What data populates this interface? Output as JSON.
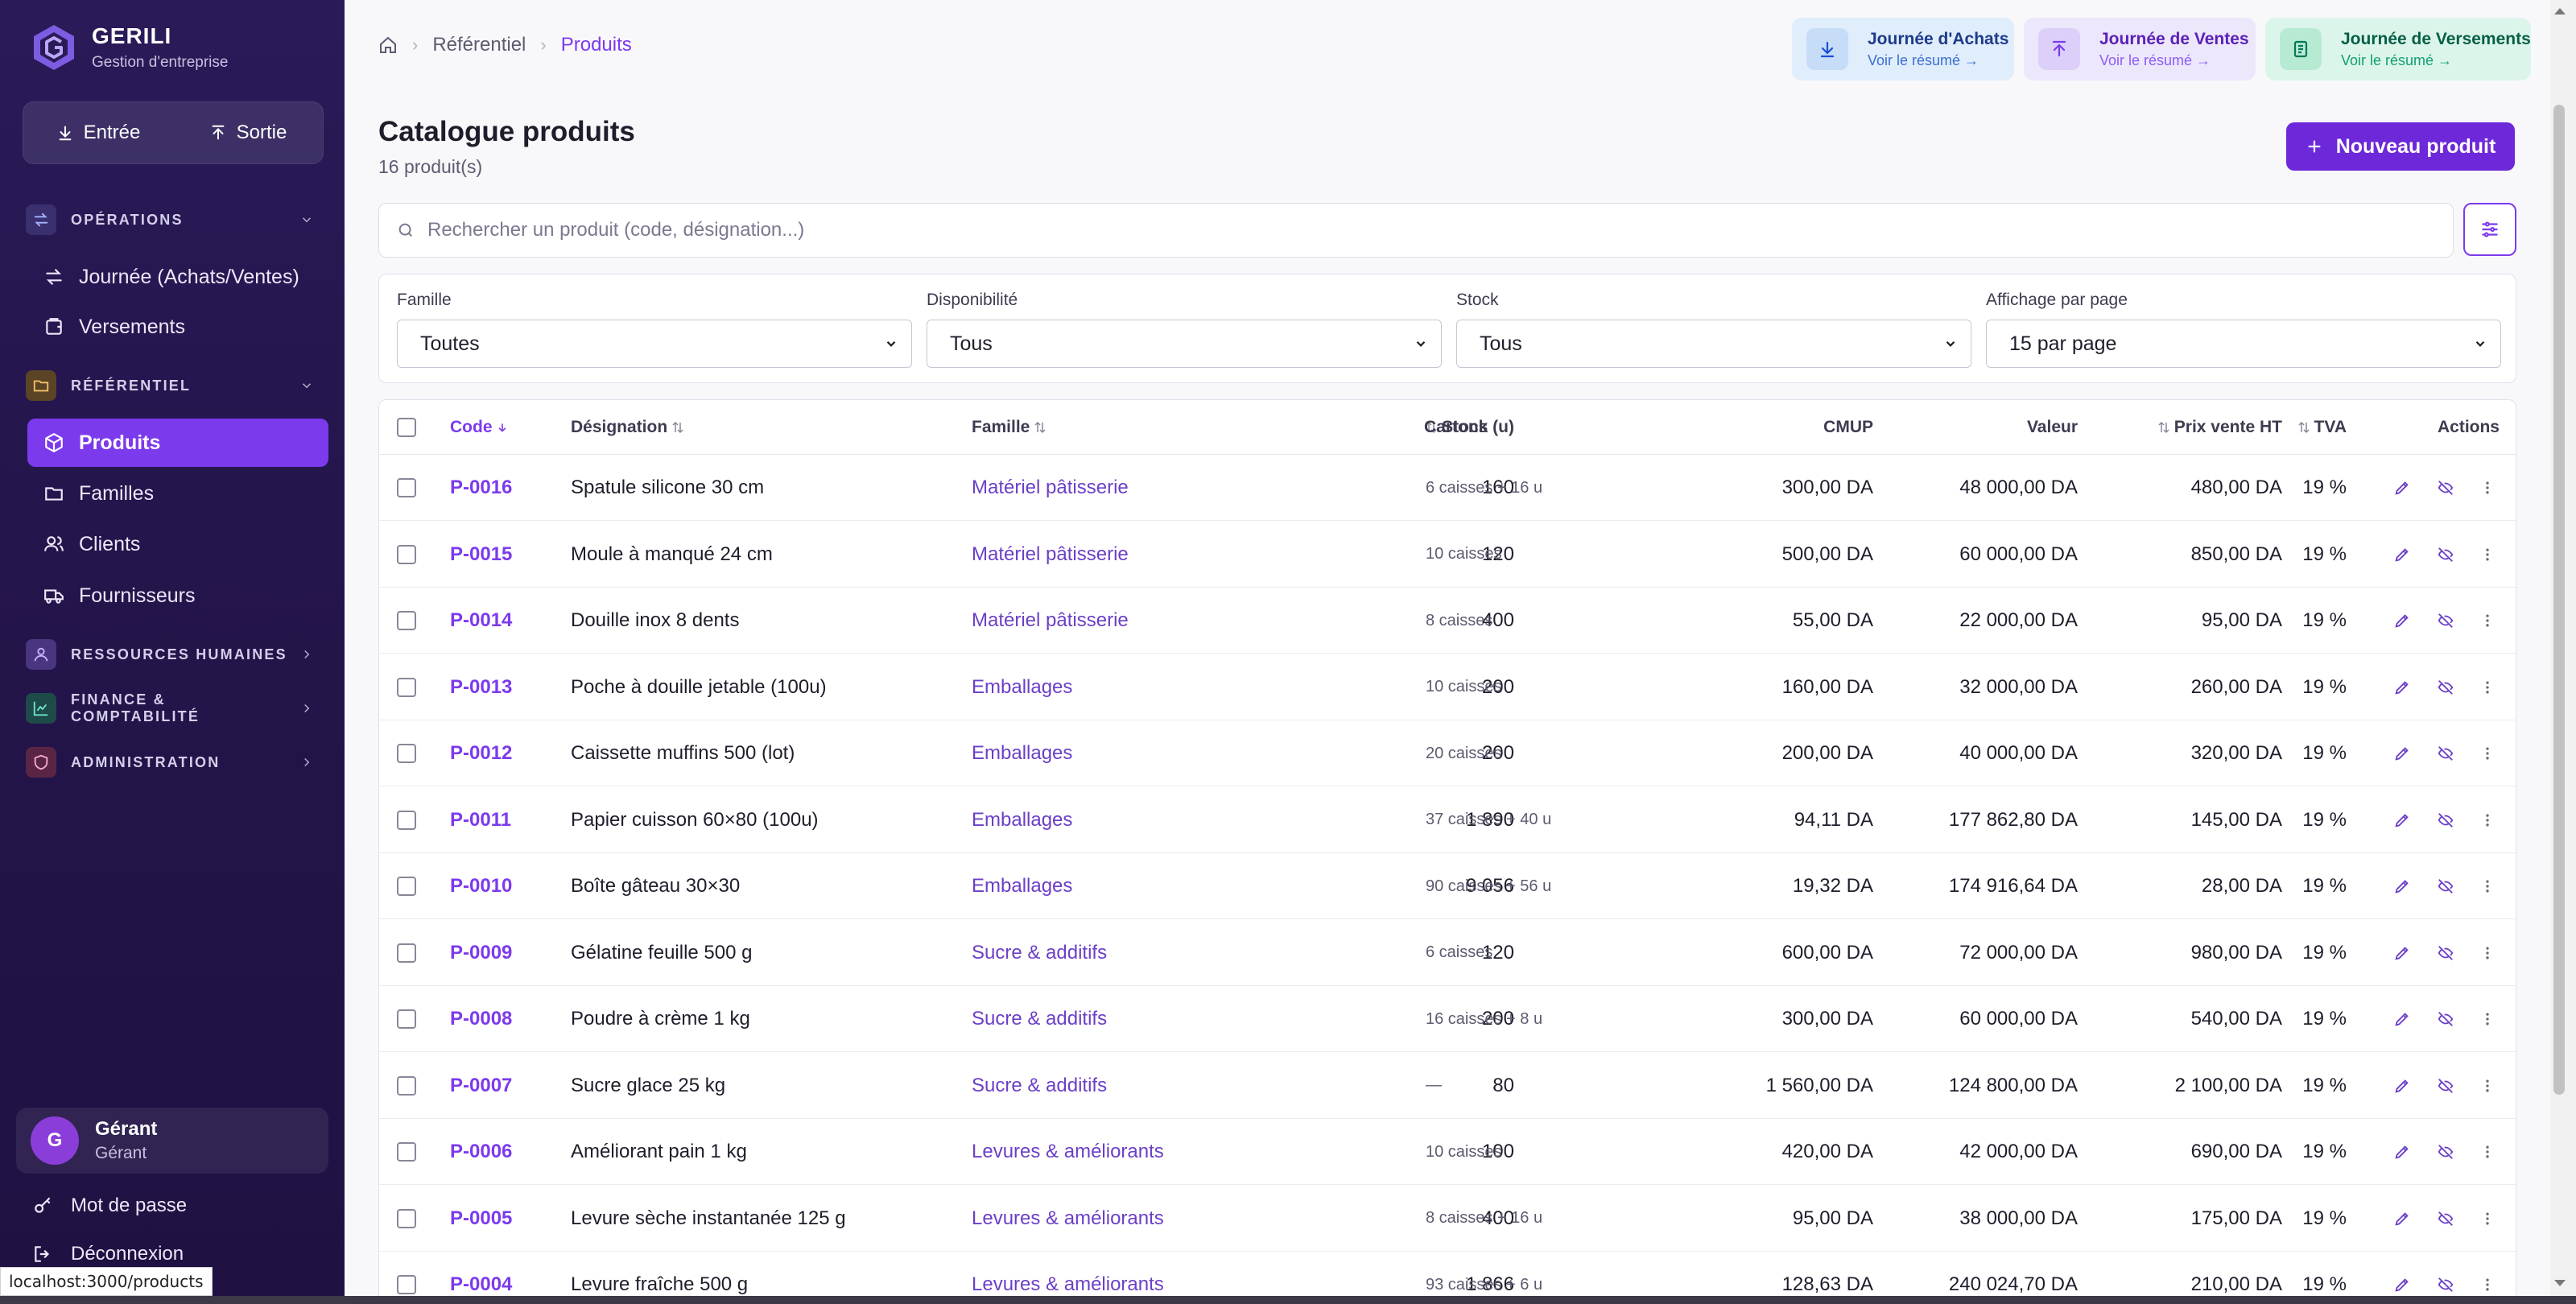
{
  "app": {
    "name": "GERILI",
    "subtitle": "Gestion d'entreprise"
  },
  "quick_actions": {
    "entree": "Entrée",
    "sortie": "Sortie"
  },
  "sidebar": {
    "sections": [
      {
        "label": "OPÉRATIONS",
        "icon": "arrows-exchange-icon",
        "expanded": true
      },
      {
        "label": "RÉFÉRENTIEL",
        "icon": "folder-icon",
        "expanded": true
      },
      {
        "label": "RESSOURCES HUMAINES",
        "icon": "user-icon",
        "expanded": false
      },
      {
        "label": "FINANCE & COMPTABILITÉ",
        "icon": "chart-line-icon",
        "expanded": false
      },
      {
        "label": "ADMINISTRATION",
        "icon": "shield-icon",
        "expanded": false
      }
    ],
    "operations_items": [
      {
        "label": "Journée (Achats/Ventes)",
        "icon": "arrows-exchange-icon"
      },
      {
        "label": "Versements",
        "icon": "wallet-icon"
      }
    ],
    "referentiel_items": [
      {
        "label": "Produits",
        "icon": "box-icon",
        "active": true
      },
      {
        "label": "Familles",
        "icon": "folder-icon"
      },
      {
        "label": "Clients",
        "icon": "users-icon"
      },
      {
        "label": "Fournisseurs",
        "icon": "truck-icon"
      }
    ]
  },
  "user": {
    "initial": "G",
    "name": "Gérant",
    "role": "Gérant"
  },
  "bottom_links": {
    "password": "Mot de passe",
    "logout": "Déconnexion"
  },
  "status_bar": {
    "url": "localhost:3000/products"
  },
  "breadcrumb": {
    "home_icon": "home-icon",
    "items": [
      "Référentiel",
      "Produits"
    ]
  },
  "journals": [
    {
      "title": "Journée d'Achats",
      "subtitle": "Voir le résumé →",
      "icon": "download-icon",
      "color": "#1d4ed8",
      "bg": "#e0edfb"
    },
    {
      "title": "Journée de Ventes",
      "subtitle": "Voir le résumé →",
      "icon": "upload-icon",
      "color": "#7c3aed",
      "bg": "#ede7fb"
    },
    {
      "title": "Journée de Versements",
      "subtitle": "Voir le résumé →",
      "icon": "receipt-icon",
      "color": "#047857",
      "bg": "#dcf5ea"
    }
  ],
  "page": {
    "title": "Catalogue produits",
    "count": "16 produit(s)",
    "new_button": "Nouveau produit"
  },
  "search": {
    "placeholder": "Rechercher un produit (code, désignation...)",
    "value": ""
  },
  "filters": [
    {
      "label": "Famille",
      "value": "Toutes"
    },
    {
      "label": "Disponibilité",
      "value": "Tous"
    },
    {
      "label": "Stock",
      "value": "Tous"
    },
    {
      "label": "Affichage par page",
      "value": "15 par page"
    }
  ],
  "table": {
    "headers": {
      "code": "Code",
      "designation": "Désignation",
      "famille": "Famille",
      "stock": "Stock (u)",
      "cartons": "Cartons",
      "cmup": "CMUP",
      "valeur": "Valeur",
      "prix": "Prix vente HT",
      "tva": "TVA",
      "actions": "Actions"
    },
    "rows": [
      {
        "code": "P-0016",
        "designation": "Spatule silicone 30 cm",
        "famille": "Matériel pâtisserie",
        "stock": "160",
        "cartons": "6 caisses + 16 u",
        "cmup": "300,00 DA",
        "valeur": "48 000,00 DA",
        "prix": "480,00 DA",
        "tva": "19 %"
      },
      {
        "code": "P-0015",
        "designation": "Moule à manqué 24 cm",
        "famille": "Matériel pâtisserie",
        "stock": "120",
        "cartons": "10 caisses",
        "cmup": "500,00 DA",
        "valeur": "60 000,00 DA",
        "prix": "850,00 DA",
        "tva": "19 %"
      },
      {
        "code": "P-0014",
        "designation": "Douille inox 8 dents",
        "famille": "Matériel pâtisserie",
        "stock": "400",
        "cartons": "8 caisses",
        "cmup": "55,00 DA",
        "valeur": "22 000,00 DA",
        "prix": "95,00 DA",
        "tva": "19 %"
      },
      {
        "code": "P-0013",
        "designation": "Poche à douille jetable (100u)",
        "famille": "Emballages",
        "stock": "200",
        "cartons": "10 caisses",
        "cmup": "160,00 DA",
        "valeur": "32 000,00 DA",
        "prix": "260,00 DA",
        "tva": "19 %"
      },
      {
        "code": "P-0012",
        "designation": "Caissette muffins 500 (lot)",
        "famille": "Emballages",
        "stock": "200",
        "cartons": "20 caisses",
        "cmup": "200,00 DA",
        "valeur": "40 000,00 DA",
        "prix": "320,00 DA",
        "tva": "19 %"
      },
      {
        "code": "P-0011",
        "designation": "Papier cuisson 60×80 (100u)",
        "famille": "Emballages",
        "stock": "1 890",
        "cartons": "37 caisses + 40 u",
        "cmup": "94,11 DA",
        "valeur": "177 862,80 DA",
        "prix": "145,00 DA",
        "tva": "19 %"
      },
      {
        "code": "P-0010",
        "designation": "Boîte gâteau 30×30",
        "famille": "Emballages",
        "stock": "9 056",
        "cartons": "90 caisses + 56 u",
        "cmup": "19,32 DA",
        "valeur": "174 916,64 DA",
        "prix": "28,00 DA",
        "tva": "19 %"
      },
      {
        "code": "P-0009",
        "designation": "Gélatine feuille 500 g",
        "famille": "Sucre & additifs",
        "stock": "120",
        "cartons": "6 caisses",
        "cmup": "600,00 DA",
        "valeur": "72 000,00 DA",
        "prix": "980,00 DA",
        "tva": "19 %"
      },
      {
        "code": "P-0008",
        "designation": "Poudre à crème 1 kg",
        "famille": "Sucre & additifs",
        "stock": "200",
        "cartons": "16 caisses + 8 u",
        "cmup": "300,00 DA",
        "valeur": "60 000,00 DA",
        "prix": "540,00 DA",
        "tva": "19 %"
      },
      {
        "code": "P-0007",
        "designation": "Sucre glace 25 kg",
        "famille": "Sucre & additifs",
        "stock": "80",
        "cartons": "—",
        "cmup": "1 560,00 DA",
        "valeur": "124 800,00 DA",
        "prix": "2 100,00 DA",
        "tva": "19 %"
      },
      {
        "code": "P-0006",
        "designation": "Améliorant pain 1 kg",
        "famille": "Levures & améliorants",
        "stock": "100",
        "cartons": "10 caisses",
        "cmup": "420,00 DA",
        "valeur": "42 000,00 DA",
        "prix": "690,00 DA",
        "tva": "19 %"
      },
      {
        "code": "P-0005",
        "designation": "Levure sèche instantanée 125 g",
        "famille": "Levures & améliorants",
        "stock": "400",
        "cartons": "8 caisses + 16 u",
        "cmup": "95,00 DA",
        "valeur": "38 000,00 DA",
        "prix": "175,00 DA",
        "tva": "19 %"
      },
      {
        "code": "P-0004",
        "designation": "Levure fraîche 500 g",
        "famille": "Levures & améliorants",
        "stock": "1 866",
        "cartons": "93 caisses + 6 u",
        "cmup": "128,63 DA",
        "valeur": "240 024,70 DA",
        "prix": "210,00 DA",
        "tva": "19 %"
      }
    ]
  },
  "colors": {
    "accent": "#7c3aed",
    "sidebar": "#24154c"
  }
}
